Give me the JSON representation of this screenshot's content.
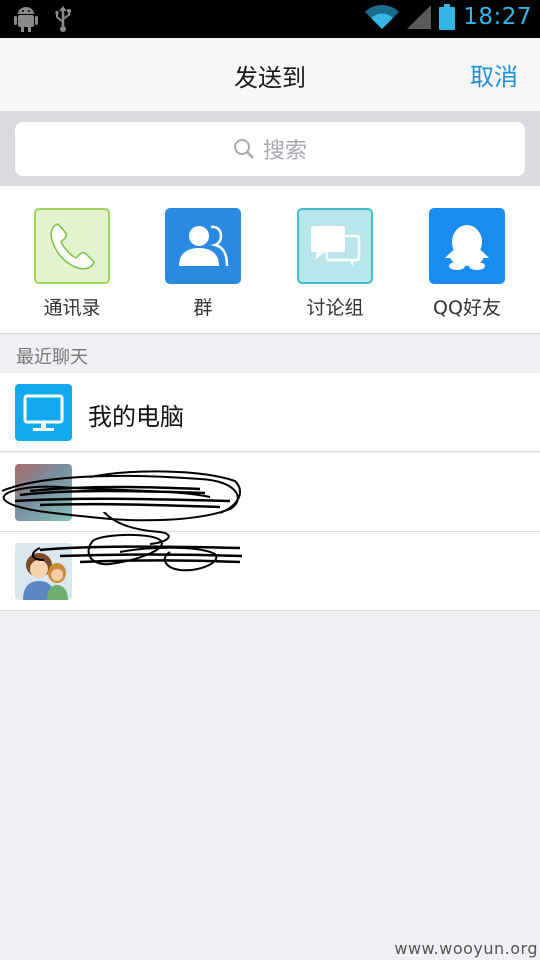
{
  "status_bar": {
    "time": "18:27",
    "left_icons": [
      "android-debug-icon",
      "usb-icon"
    ],
    "right_icons": [
      "wifi-icon",
      "signal-icon",
      "battery-icon"
    ],
    "accent_color": "#33b5e5"
  },
  "header": {
    "title": "发送到",
    "cancel_label": "取消",
    "accent_color": "#1e90d8"
  },
  "search": {
    "placeholder": "搜索"
  },
  "quick_actions": [
    {
      "label": "通讯录",
      "icon": "phone-icon",
      "color": "#e2f1cc"
    },
    {
      "label": "群",
      "icon": "group-icon",
      "color": "#2a8ae2"
    },
    {
      "label": "讨论组",
      "icon": "discussion-icon",
      "color": "#b7e6ea"
    },
    {
      "label": "QQ好友",
      "icon": "qq-penguin-icon",
      "color": "#1a8cf0"
    }
  ],
  "recent": {
    "section_title": "最近聊天",
    "items": [
      {
        "name": "我的电脑",
        "avatar": "computer-icon"
      },
      {
        "name": "",
        "avatar": "photo-avatar",
        "redacted": true
      },
      {
        "name": "",
        "avatar": "cartoon-avatar",
        "redacted": true
      }
    ]
  },
  "watermark": "www.wooyun.org"
}
